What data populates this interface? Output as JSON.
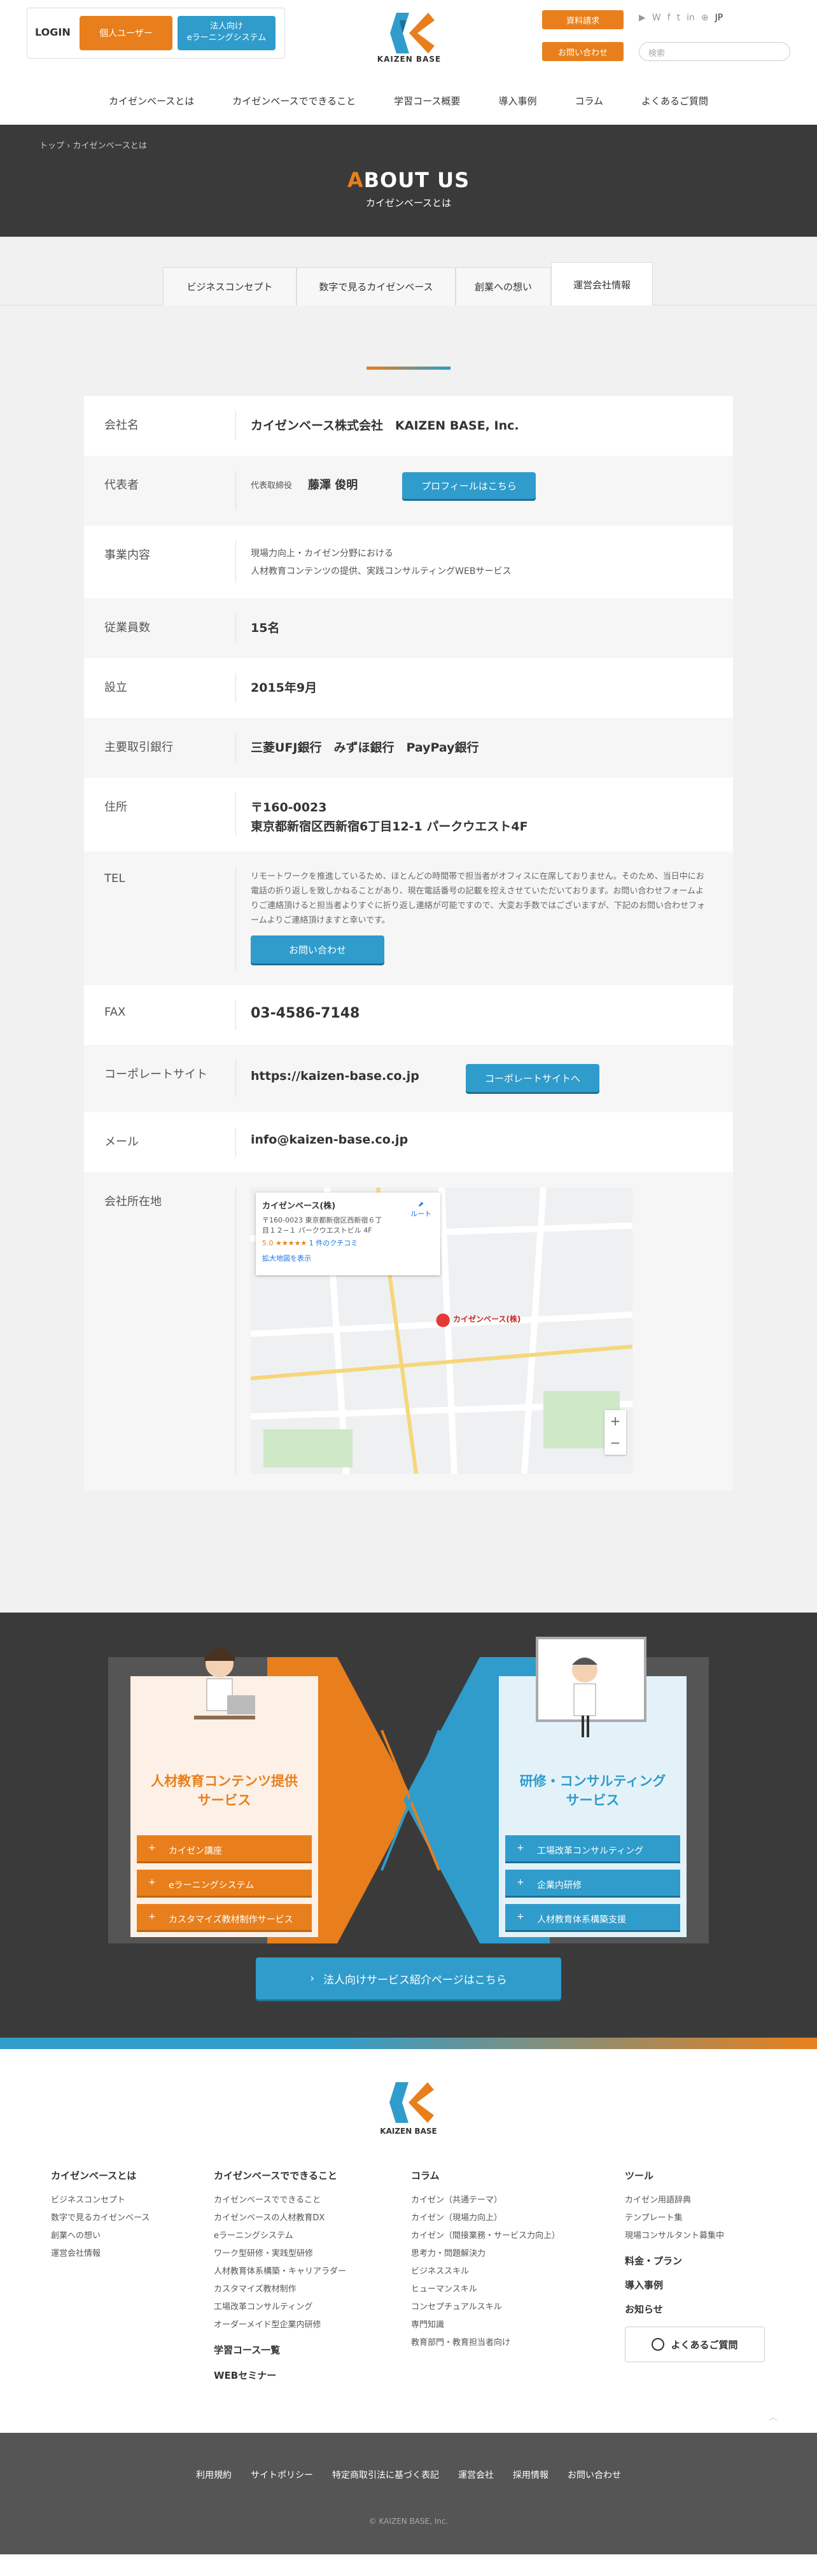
{
  "header": {
    "login_label": "LOGIN",
    "login_personal": "個人ユーザー",
    "login_corp": "法人向け\neラーニングシステム",
    "logo_text": "KAIZEN BASE",
    "btn_docs": "資料請求",
    "btn_contact": "お問い合わせ",
    "lang": "JP",
    "search_placeholder": "検索",
    "nav": [
      "カイゼンベースとは",
      "カイゼンベースでできること",
      "学習コース概要",
      "導入事例",
      "コラム",
      "よくあるご質問"
    ]
  },
  "hero": {
    "breadcrumb_home": "トップ",
    "breadcrumb_current": "カイゼンベースとは",
    "title_accent": "A",
    "title_rest": "BOUT US",
    "subtitle": "カイゼンベースとは"
  },
  "tabs": [
    "ビジネスコンセプト",
    "数字で見るカイゼンベース",
    "創業への想い",
    "運営会社情報"
  ],
  "company": {
    "name_label": "会社名",
    "name_value": "カイゼンベース株式会社　KAIZEN BASE, Inc.",
    "rep_label": "代表者",
    "rep_title": "代表取締役",
    "rep_name": "藤澤 俊明",
    "rep_btn": "プロフィールはこちら",
    "biz_label": "事業内容",
    "biz_line1": "現場力向上・カイゼン分野における",
    "biz_line2": "人材教育コンテンツの提供、実践コンサルティングWEBサービス",
    "emp_label": "従業員数",
    "emp_value": "15名",
    "est_label": "設立",
    "est_value": "2015年9月",
    "bank_label": "主要取引銀行",
    "bank_value": "三菱UFJ銀行　みずほ銀行　PayPay銀行",
    "addr_label": "住所",
    "addr_zip": "〒160-0023",
    "addr_value": "東京都新宿区西新宿6丁目12-1 パークウエスト4F",
    "tel_label": "TEL",
    "tel_note": "リモートワークを推進しているため、ほとんどの時間帯で担当者がオフィスに在席しておりません。そのため、当日中にお電話の折り返しを致しかねることがあり、現在電話番号の記載を控えさせていただいております。お問い合わせフォームよりご連絡頂けると担当者よりすぐに折り返し連絡が可能ですので、大変お手数ではございますが、下記のお問い合わせフォームよりご連絡頂けますと幸いです。",
    "tel_btn": "お問い合わせ",
    "fax_label": "FAX",
    "fax_value": "03-4586-7148",
    "site_label": "コーポレートサイト",
    "site_value": "https://kaizen-base.co.jp",
    "site_btn": "コーポレートサイトへ",
    "mail_label": "メール",
    "mail_value": "info@kaizen-base.co.jp",
    "map_label": "会社所在地",
    "map_card_title": "カイゼンベース(株)",
    "map_card_addr": "〒160-0023 東京都新宿区西新宿６丁目１２−１ パークウエストビル 4F",
    "map_card_rating": "5.0 ★★★★★",
    "map_card_reviews": "1 件のクチコミ",
    "map_card_link": "拡大地図を表示",
    "map_route": "ルート",
    "map_pin": "カイゼンベース(株)"
  },
  "services": {
    "left_title": "人材教育コンテンツ提供\nサービス",
    "left_items": [
      "カイゼン講座",
      "eラーニングシステム",
      "カスタマイズ教材制作サービス"
    ],
    "right_title": "研修・コンサルティング\nサービス",
    "right_items": [
      "工場改革コンサルティング",
      "企業内研修",
      "人材教育体系構築支援"
    ],
    "cta": "法人向けサービス紹介ページはこちら"
  },
  "footer": {
    "logo_text": "KAIZEN BASE",
    "col1_title": "カイゼンベースとは",
    "col1": [
      "ビジネスコンセプト",
      "数字で見るカイゼンベース",
      "創業への想い",
      "運営会社情報"
    ],
    "col2_title": "カイゼンベースでできること",
    "col2": [
      "カイゼンベースでできること",
      "カイゼンベースの人材教育DX",
      "eラーニングシステム",
      "ワーク型研修・実践型研修",
      "人材教育体系構築・キャリアラダー",
      "カスタマイズ教材制作",
      "工場改革コンサルティング",
      "オーダーメイド型企業内研修"
    ],
    "col2_extra1": "学習コース一覧",
    "col2_extra2": "WEBセミナー",
    "col3_title": "コラム",
    "col3": [
      "カイゼン（共通テーマ）",
      "カイゼン（現場力向上）",
      "カイゼン（間接業務・サービス力向上）",
      "思考力・問題解決力",
      "ビジネススキル",
      "ヒューマンスキル",
      "コンセプチュアルスキル",
      "専門知識",
      "教育部門・教育担当者向け"
    ],
    "col4_title": "ツール",
    "col4": [
      "カイゼン用語辞典",
      "テンプレート集",
      "現場コンサルタント募集中"
    ],
    "col4_plan": "料金・プラン",
    "col4_cases": "導入事例",
    "col4_news": "お知らせ",
    "faq_btn": "よくあるご質問",
    "bottom_links": [
      "利用規約",
      "サイトポリシー",
      "特定商取引法に基づく表記",
      "運営会社",
      "採用情報",
      "お問い合わせ"
    ],
    "copyright": "© KAIZEN BASE, Inc."
  },
  "colors": {
    "accent": "#e87f1c",
    "brand_blue": "#2f9ccc",
    "dark": "#3a3a3a"
  }
}
